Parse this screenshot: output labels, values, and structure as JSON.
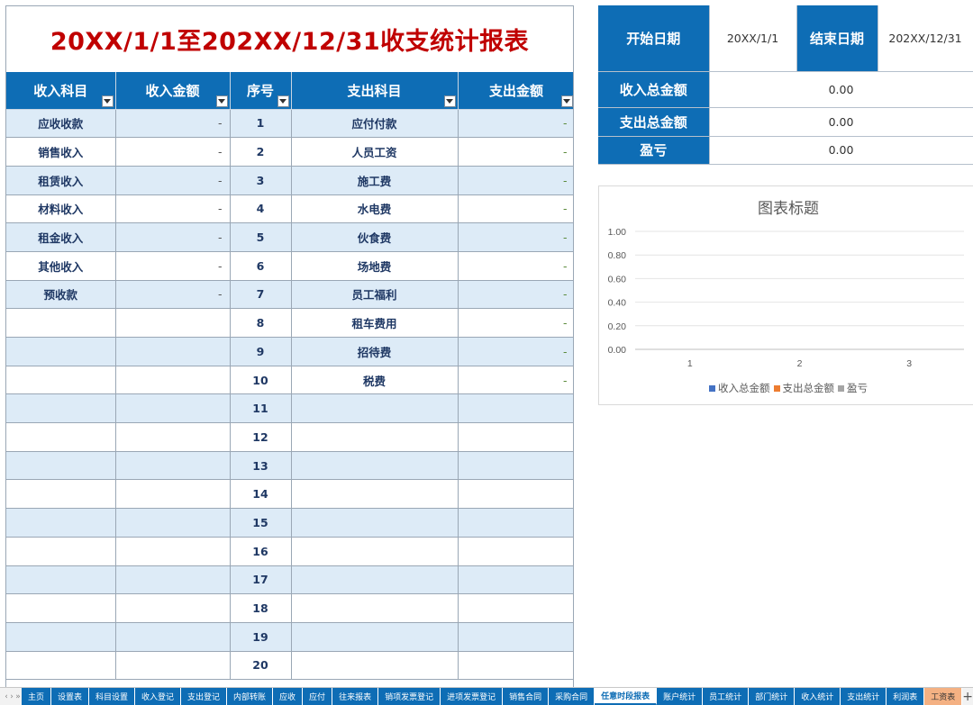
{
  "report": {
    "title": "20XX/1/1至202XX/12/31收支统计报表",
    "headers": [
      "收入科目",
      "收入金额",
      "序号",
      "支出科目",
      "支出金额"
    ],
    "rows": [
      {
        "income": "应收收款",
        "income_amt": "-",
        "seq": "1",
        "expense": "应付付款",
        "expense_amt": "-"
      },
      {
        "income": "销售收入",
        "income_amt": "-",
        "seq": "2",
        "expense": "人员工资",
        "expense_amt": "-"
      },
      {
        "income": "租赁收入",
        "income_amt": "-",
        "seq": "3",
        "expense": "施工费",
        "expense_amt": "-"
      },
      {
        "income": "材料收入",
        "income_amt": "-",
        "seq": "4",
        "expense": "水电费",
        "expense_amt": "-"
      },
      {
        "income": "租金收入",
        "income_amt": "-",
        "seq": "5",
        "expense": "伙食费",
        "expense_amt": "-"
      },
      {
        "income": "其他收入",
        "income_amt": "-",
        "seq": "6",
        "expense": "场地费",
        "expense_amt": "-"
      },
      {
        "income": "预收款",
        "income_amt": "-",
        "seq": "7",
        "expense": "员工福利",
        "expense_amt": "-"
      },
      {
        "income": "",
        "income_amt": "",
        "seq": "8",
        "expense": "租车费用",
        "expense_amt": "-"
      },
      {
        "income": "",
        "income_amt": "",
        "seq": "9",
        "expense": "招待费",
        "expense_amt": "-"
      },
      {
        "income": "",
        "income_amt": "",
        "seq": "10",
        "expense": "税费",
        "expense_amt": "-"
      },
      {
        "income": "",
        "income_amt": "",
        "seq": "11",
        "expense": "",
        "expense_amt": ""
      },
      {
        "income": "",
        "income_amt": "",
        "seq": "12",
        "expense": "",
        "expense_amt": ""
      },
      {
        "income": "",
        "income_amt": "",
        "seq": "13",
        "expense": "",
        "expense_amt": ""
      },
      {
        "income": "",
        "income_amt": "",
        "seq": "14",
        "expense": "",
        "expense_amt": ""
      },
      {
        "income": "",
        "income_amt": "",
        "seq": "15",
        "expense": "",
        "expense_amt": ""
      },
      {
        "income": "",
        "income_amt": "",
        "seq": "16",
        "expense": "",
        "expense_amt": ""
      },
      {
        "income": "",
        "income_amt": "",
        "seq": "17",
        "expense": "",
        "expense_amt": ""
      },
      {
        "income": "",
        "income_amt": "",
        "seq": "18",
        "expense": "",
        "expense_amt": ""
      },
      {
        "income": "",
        "income_amt": "",
        "seq": "19",
        "expense": "",
        "expense_amt": ""
      },
      {
        "income": "",
        "income_amt": "",
        "seq": "20",
        "expense": "",
        "expense_amt": ""
      }
    ]
  },
  "summary": {
    "start_label": "开始日期",
    "start_value": "20XX/1/1",
    "end_label": "结束日期",
    "end_value": "202XX/12/31",
    "income_total_label": "收入总金额",
    "income_total": "0.00",
    "expense_total_label": "支出总金额",
    "expense_total": "0.00",
    "profit_label": "盈亏",
    "profit": "0.00"
  },
  "chart_data": {
    "type": "bar",
    "title": "图表标题",
    "categories": [
      "1",
      "2",
      "3"
    ],
    "y_ticks": [
      "1.00",
      "0.80",
      "0.60",
      "0.40",
      "0.20",
      "0.00"
    ],
    "ylim": [
      0,
      1
    ],
    "series": [
      {
        "name": "收入总金额",
        "color": "#4472c4",
        "values": [
          0,
          0,
          0
        ]
      },
      {
        "name": "支出总金额",
        "color": "#ed7d31",
        "values": [
          0,
          0,
          0
        ]
      },
      {
        "name": "盈亏",
        "color": "#a5a5a5",
        "values": [
          0,
          0,
          0
        ]
      }
    ],
    "legend_position": "bottom",
    "grid": true
  },
  "sheet_tabs": {
    "items": [
      "主页",
      "设置表",
      "科目设置",
      "收入登记",
      "支出登记",
      "内部转账",
      "应收",
      "应付",
      "往来报表",
      "销项发票登记",
      "进项发票登记",
      "销售合同",
      "采购合同",
      "任意时段报表",
      "账户统计",
      "员工统计",
      "部门统计",
      "收入统计",
      "支出统计",
      "利润表",
      "工资表"
    ],
    "active_index": 13,
    "highlight_index": 20,
    "add_label": "+"
  }
}
